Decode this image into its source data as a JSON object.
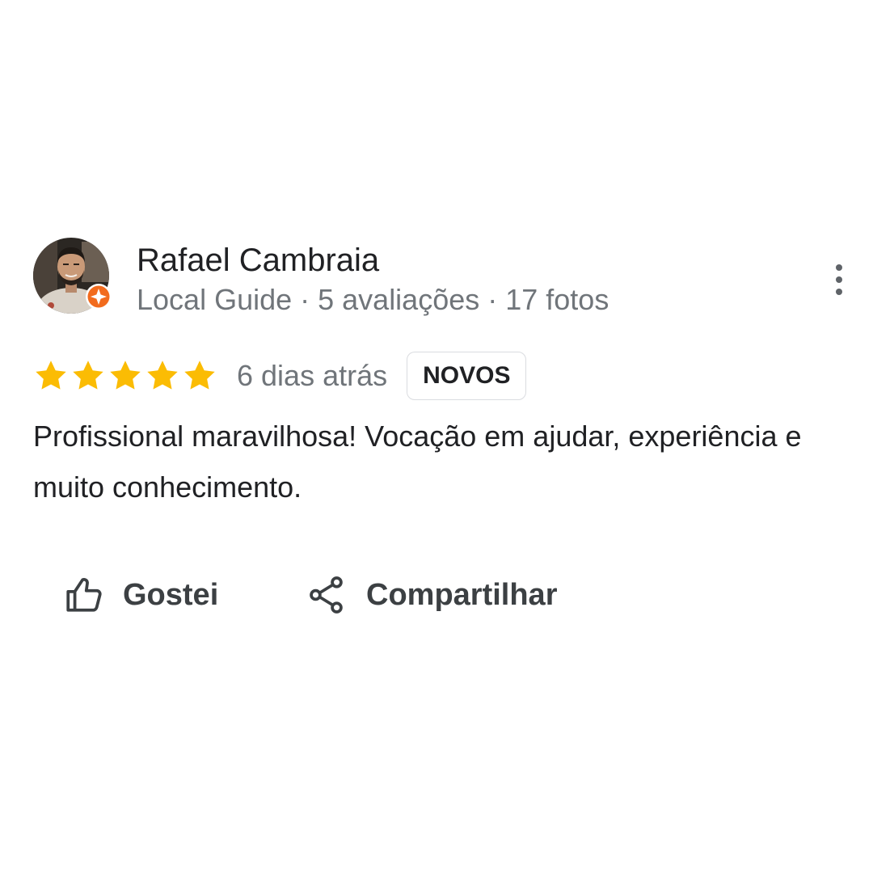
{
  "review": {
    "author_name": "Rafael Cambraia",
    "author_meta": "Local Guide · 5 avaliações · 17 fotos",
    "avatar_icon": "profile-photo",
    "badge_icon": "local-guide-badge-icon",
    "rating": 5,
    "rating_max": 5,
    "date": "6 dias atrás",
    "tag": "NOVOS",
    "text": "Profissional maravilhosa! Vocação em ajudar, experiência e muito conhecimento.",
    "more_icon": "more-vert-icon"
  },
  "actions": {
    "like_label": "Gostei",
    "like_icon": "thumb-up-icon",
    "share_label": "Compartilhar",
    "share_icon": "share-icon"
  },
  "colors": {
    "star": "#fbbc04",
    "guide_badge": "#f26b1d",
    "secondary_text": "#70757a",
    "primary_text": "#202124"
  }
}
